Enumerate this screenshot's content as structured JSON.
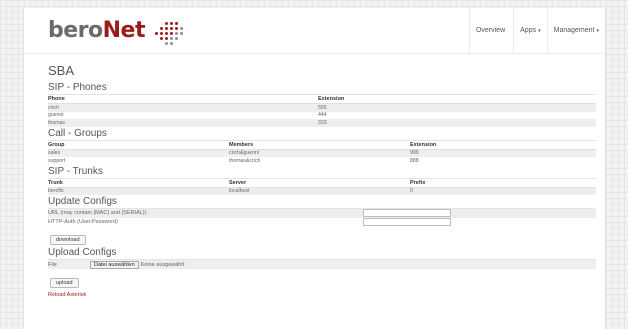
{
  "brand": {
    "name_main": "bero",
    "name_accent": "Net"
  },
  "nav": [
    {
      "label": "Overview",
      "caret": ""
    },
    {
      "label": "Apps",
      "caret": "▾"
    },
    {
      "label": "Management",
      "caret": "▾"
    }
  ],
  "page_title": "SBA",
  "sip_phones": {
    "title": "SIP - Phones",
    "headers": [
      "Phone",
      "Extension"
    ],
    "rows": [
      [
        "crich",
        "555"
      ],
      [
        "guenni",
        "444"
      ],
      [
        "thomas",
        "333"
      ]
    ]
  },
  "call_groups": {
    "title": "Call - Groups",
    "headers": [
      "Group",
      "Members",
      "Extension"
    ],
    "rows": [
      [
        "sales",
        "crich&guenni",
        "999"
      ],
      [
        "support",
        "thomas&crich",
        "888"
      ]
    ]
  },
  "sip_trunks": {
    "title": "SIP - Trunks",
    "headers": [
      "Trunk",
      "Server",
      "Prefix"
    ],
    "rows": [
      [
        "beroflx",
        "localhost",
        "0"
      ]
    ]
  },
  "update_configs": {
    "title": "Update Configs",
    "url_label": "URL (may contain {MAC} and {SERIAL})",
    "url_value": "",
    "auth_label": "HTTP-Auth (User:Password)",
    "auth_value": "",
    "button": "download"
  },
  "upload_configs": {
    "title": "Upload Configs",
    "file_label": "File",
    "file_button": "Datei auswählen",
    "file_status": "Keine ausgewählt",
    "button": "upload"
  },
  "reload_link": "Reload Asterisk",
  "colors": {
    "brand_red": "#9b1b1b",
    "brand_gray": "#6b6b6b"
  }
}
